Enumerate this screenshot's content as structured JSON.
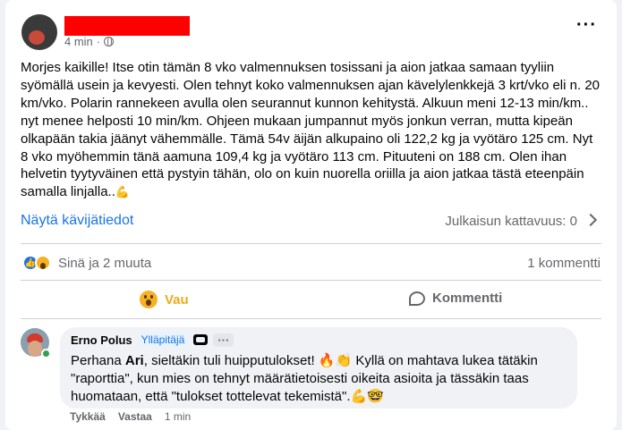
{
  "post": {
    "time": "4 min",
    "body": "Morjes kaikille! Itse otin tämän 8 vko valmennuksen tosissani ja aion jatkaa samaan tyyliin syömällä usein ja kevyesti. Olen tehnyt koko valmennuksen ajan kävelylenkkejä 3 krt/vko eli n. 20 km/vko. Polarin rannekeen avulla olen seurannut kunnon kehitystä. Alkuun meni 12-13 min/km.. nyt menee helposti 10 min/km. Ohjeen mukaan jumpannut myös jonkun verran, mutta kipeän olkapään takia jäänyt vähemmälle. Tämä 54v äijän alkupaino oli 122,2 kg ja vyötäro 125 cm. Nyt 8 vko myöhemmin tänä aamuna 109,4 kg ja vyötäro 113 cm. Pituuteni on 188 cm. Olen ihan helvetin tyytyväinen että pystyin tähän, olo on kuin nuorella oriilla ja aion jatkaa tästä eteenpäin samalla linjalla..",
    "body_emoji": "💪",
    "insights_label": "Näytä kävijätiedot",
    "reach_label": "Julkaisun kattavuus: 0"
  },
  "reactions": {
    "summary": "Sinä ja 2 muuta",
    "comments_count": "1 kommentti"
  },
  "actions": {
    "react_label": "Vau",
    "comment_label": "Kommentti"
  },
  "comment": {
    "author": "Erno Polus",
    "badge": "Ylläpitäjä",
    "text_before": "Perhana ",
    "mention": "Ari",
    "text_after": ", sieltäkin tuli huipputulokset! 🔥👏 Kyllä on mahtava lukea tätäkin \"raporttia\", kun mies on tehnyt määrätietoisesti oikeita asioita ja tässäkin taas huomataan, että \"tulokset tottelevat tekemistä\".💪🤓",
    "like_label": "Tykkää",
    "reply_label": "Vastaa",
    "time": "1 min"
  },
  "colors": {
    "accent": "#1b74e4",
    "wow": "#e9ac1f",
    "muted": "#65676b"
  }
}
